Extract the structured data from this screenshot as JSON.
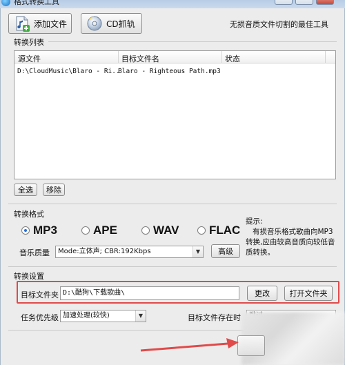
{
  "window": {
    "title": "格式转换工具"
  },
  "toolbar": {
    "add_file": "添加文件",
    "cd_rip": "CD抓轨",
    "tagline": "无损音质文件切割的最佳工具"
  },
  "convert_list": {
    "title": "转换列表",
    "columns": [
      "源文件",
      "目标文件名",
      "状态"
    ],
    "rows": [
      {
        "source": "D:\\CloudMusic\\Blaro - Ri..",
        "target": "Blaro - Righteous Path.mp3",
        "status": ""
      }
    ],
    "select_all": "全选",
    "remove": "移除"
  },
  "format": {
    "title": "转换格式",
    "options": [
      "MP3",
      "APE",
      "WAV",
      "FLAC"
    ],
    "selected": "MP3",
    "quality_label": "音乐质量",
    "quality_value": "Mode:立体声; CBR:192Kbps",
    "advanced": "高级",
    "hint_title": "提示:",
    "hint_text": "有损音乐格式歌曲向MP3转换,应由较高音质向较低音质转换。"
  },
  "settings": {
    "title": "转换设置",
    "target_folder_label": "目标文件夹",
    "target_folder_value": "D:\\酷狗\\下载歌曲\\",
    "change": "更改",
    "open_folder": "打开文件夹",
    "priority_label": "任务优先级",
    "priority_value": "加速处理(较快)",
    "exists_label": "目标文件存在时",
    "exists_value": "跳过"
  },
  "colors": {
    "highlight": "#e04a4a",
    "arrow": "#e04a4a",
    "radio_selected": "#2a6fd1"
  },
  "icons": {
    "add_file": "music-file-add-icon",
    "cd_rip": "cd-icon",
    "app": "app-globe-icon"
  }
}
